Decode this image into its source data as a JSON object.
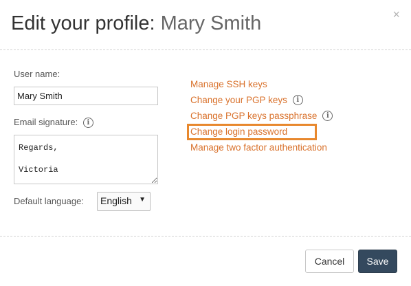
{
  "dialog": {
    "title_prefix": "Edit your profile:",
    "title_name": "Mary Smith",
    "close_glyph": "×"
  },
  "form": {
    "username_label": "User name:",
    "username_value": "Mary Smith",
    "signature_label": "Email signature:",
    "signature_value": "Regards,\n\nVictoria",
    "language_label": "Default language:",
    "language_selected": "English",
    "info_glyph": "i"
  },
  "links": {
    "ssh": "Manage SSH keys",
    "pgp": "Change your PGP keys",
    "pgp_pass": "Change PGP keys passphrase",
    "login_password": "Change login password",
    "two_factor": "Manage two factor authentication"
  },
  "footer": {
    "cancel_label": "Cancel",
    "save_label": "Save"
  },
  "colors": {
    "link": "#d9712b",
    "highlight": "#e8882d",
    "primary_button": "#34495e"
  }
}
